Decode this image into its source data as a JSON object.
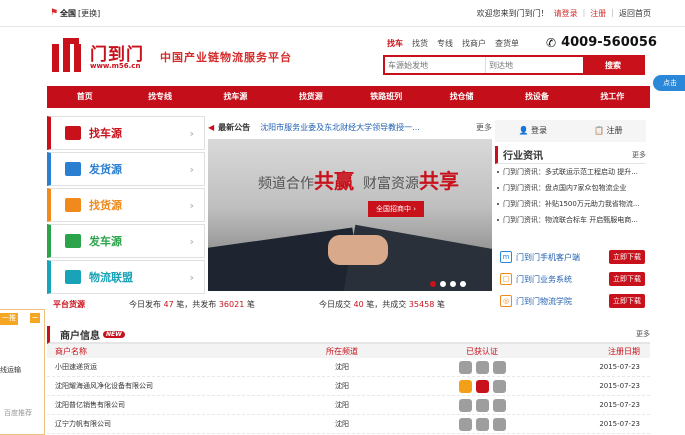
{
  "topbar": {
    "location": "全国",
    "switch": "[更换]",
    "welcome": "欢迎您来到门到门！",
    "login": "请登录",
    "register": "注册",
    "home": "返回首页"
  },
  "logo": {
    "name": "门到门",
    "url": "www.m56.cn",
    "slogan": "中国产业链物流服务平台"
  },
  "search": {
    "tabs": [
      "找车",
      "找货",
      "专线",
      "找商户",
      "查货单"
    ],
    "active_tab": "找车",
    "from_placeholder": "车源始发地",
    "to_placeholder": "到达地",
    "button": "搜索"
  },
  "phone": "4009-560056",
  "side_widget": "点击",
  "nav": [
    "首页",
    "找专线",
    "找车源",
    "找货源",
    "铁路班列",
    "找仓储",
    "找设备",
    "找工作"
  ],
  "categories": [
    {
      "label": "找车源",
      "color": "#c9111b"
    },
    {
      "label": "发货源",
      "color": "#2b7fd0"
    },
    {
      "label": "找货源",
      "color": "#f08a1c"
    },
    {
      "label": "发车源",
      "color": "#2aa34a"
    },
    {
      "label": "物流联盟",
      "color": "#19a3b8"
    }
  ],
  "ticker": {
    "title": "最新公告",
    "text": "沈阳市服务业委及东北财经大学领导教授一...",
    "more": "更多"
  },
  "banner": {
    "text1": "频道合作",
    "em1": "共赢",
    "text2": "财富资源",
    "em2": "共享",
    "button": "全国招商中 ›"
  },
  "stats": {
    "label": "平台货源",
    "today_pub_prefix": "今日发布",
    "today_pub": "47",
    "unit": "笔",
    "total_pub_prefix": "，共发布",
    "total_pub": "36021",
    "today_deal_prefix": "今日成交",
    "today_deal": "40",
    "total_deal_prefix": "，共成交",
    "total_deal": "35458"
  },
  "auth": {
    "login": "登录",
    "register": "注册"
  },
  "news": {
    "title": "行业资讯",
    "more": "更多",
    "items": [
      "门到门资讯：多式联运示范工程启动 提升...",
      "门到门资讯：盘点国内7家众包物流企业",
      "门到门资讯：补贴1500万元助力我省物流...",
      "门到门资讯：物流联合标车 开启甄服电商..."
    ]
  },
  "downloads": [
    {
      "label": "门到门手机客户端",
      "button": "立即下载"
    },
    {
      "label": "门到门业务系统",
      "button": "立即下载"
    },
    {
      "label": "门到门物流学院",
      "button": "立即下载"
    }
  ],
  "merchants": {
    "title": "商户信息",
    "badge": "NEW",
    "more": "更多",
    "headers": [
      "商户名称",
      "所在频道",
      "已获认证",
      "注册日期"
    ],
    "rows": [
      {
        "name": "小田速递货运",
        "channel": "沈阳",
        "date": "2015-07-23"
      },
      {
        "name": "沈阳耀海通风净化设备有限公司",
        "channel": "沈阳",
        "date": "2015-07-23"
      },
      {
        "name": "沈阳普亿销售有限公司",
        "channel": "沈阳",
        "date": "2015-07-23"
      },
      {
        "name": "辽宁力帆有限公司",
        "channel": "沈阳",
        "date": "2015-07-23"
      }
    ]
  },
  "left_tab": {
    "label": "一推",
    "text": "线运输",
    "recommend": "百度推荐"
  }
}
